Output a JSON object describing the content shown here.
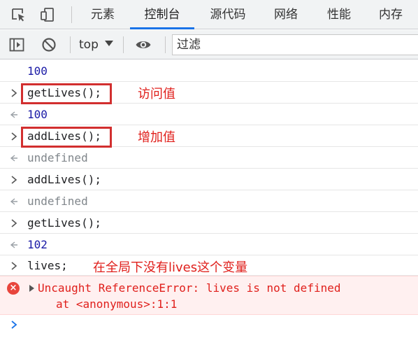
{
  "tabs": [
    {
      "label": "元素",
      "active": false
    },
    {
      "label": "控制台",
      "active": true
    },
    {
      "label": "源代码",
      "active": false
    },
    {
      "label": "网络",
      "active": false
    },
    {
      "label": "性能",
      "active": false
    },
    {
      "label": "内存",
      "active": false
    }
  ],
  "toolbar": {
    "context": "top",
    "filter_placeholder": "过滤"
  },
  "console": {
    "line1": "100",
    "line2_cmd": "getLives();",
    "line2_note": "访问值",
    "line3": "100",
    "line4_cmd": "addLives();",
    "line4_note": "增加值",
    "line5": "undefined",
    "line6_cmd": "addLives();",
    "line7": "undefined",
    "line8_cmd": "getLives();",
    "line9": "102",
    "line10_cmd": "lives;",
    "line10_note": "在全局下没有lives这个变量",
    "error_icon": "×",
    "error_line1": "Uncaught ReferenceError: lives is not defined",
    "error_line2": "at <anonymous>:1:1"
  },
  "colors": {
    "accent": "#1a73e8",
    "error": "#e0201c",
    "number": "#1a1aa6",
    "annotation": "#e0201c"
  }
}
